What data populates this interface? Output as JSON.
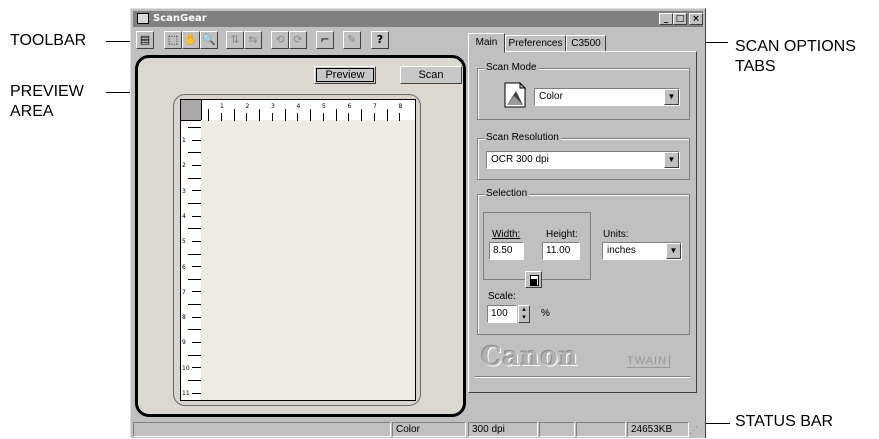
{
  "callouts": {
    "toolbar": "TOOLBAR",
    "preview_line1": "PREVIEW",
    "preview_line2": "AREA",
    "scan_options_line1": "SCAN OPTIONS",
    "scan_options_line2": "TABS",
    "status_bar": "STATUS BAR"
  },
  "window": {
    "title": "ScanGear",
    "minimize": "_",
    "maximize": "□",
    "close": "×"
  },
  "preview": {
    "preview_button": "Preview",
    "scan_button": "Scan",
    "ruler_h": [
      "1",
      "2",
      "3",
      "4",
      "5",
      "6",
      "7",
      "8"
    ],
    "ruler_v": [
      "1",
      "2",
      "3",
      "4",
      "5",
      "6",
      "7",
      "8",
      "9",
      "10",
      "11"
    ]
  },
  "tabs": [
    {
      "label": "Main"
    },
    {
      "label": "Preferences"
    },
    {
      "label": "C3500"
    }
  ],
  "scan_mode": {
    "label": "Scan Mode",
    "value": "Color"
  },
  "scan_resolution": {
    "label": "Scan Resolution",
    "value": "OCR 300 dpi"
  },
  "selection": {
    "label": "Selection",
    "width_label": "Width:",
    "width_value": "8.50",
    "height_label": "Height:",
    "height_value": "11.00",
    "units_label": "Units:",
    "units_value": "inches",
    "scale_label": "Scale:",
    "scale_value": "100",
    "scale_unit": "%"
  },
  "branding": {
    "logo": "Canon",
    "twain": "TWAIN"
  },
  "status_bar": {
    "mode": "Color",
    "resolution": "300 dpi",
    "size": "24653KB"
  }
}
